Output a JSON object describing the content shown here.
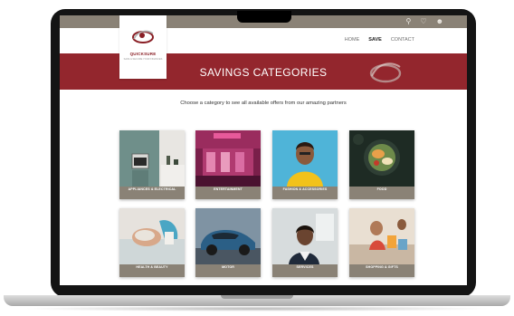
{
  "brand": {
    "name": "QUICKSURE",
    "tagline": "SAVE & SECURE YOUR FINANCES",
    "primary_color": "#93262d",
    "accent_color": "#8a8276"
  },
  "topbar": {
    "icons": [
      "search-icon",
      "heart-icon",
      "user-icon"
    ]
  },
  "nav": {
    "items": [
      {
        "label": "HOME",
        "active": false
      },
      {
        "label": "SAVE",
        "active": true
      },
      {
        "label": "CONTACT",
        "active": false
      }
    ]
  },
  "banner": {
    "title": "SAVINGS CATEGORIES"
  },
  "intro_text": "Choose a category to see all available offers from our amazing partners",
  "categories": [
    {
      "label": "APPLIANCES & ELECTRICAL"
    },
    {
      "label": "ENTERTAINMENT"
    },
    {
      "label": "FASHION & ACCESSORIES"
    },
    {
      "label": "FOOD"
    },
    {
      "label": "HEALTH & BEAUTY"
    },
    {
      "label": "MOTOR"
    },
    {
      "label": "SERVICES"
    },
    {
      "label": "SHOPPING & GIFTS"
    }
  ]
}
